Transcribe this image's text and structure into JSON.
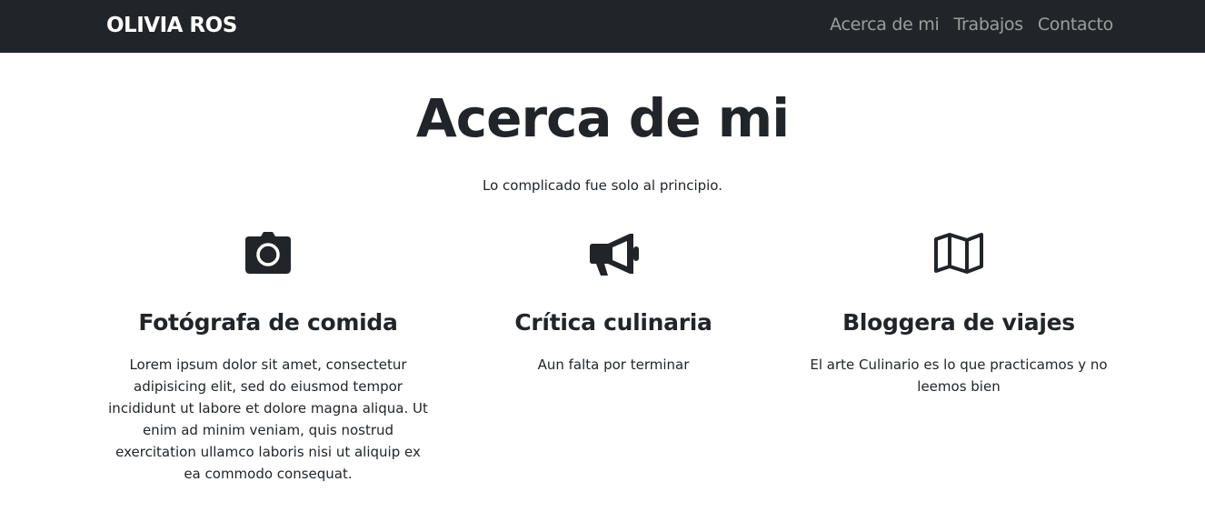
{
  "navbar": {
    "brand": "OLIVIA ROS",
    "links": [
      "Acerca de mi",
      "Trabajos",
      "Contacto"
    ]
  },
  "hero": {
    "title": "Acerca de mi",
    "subtitle": "Lo complicado fue solo al principio."
  },
  "features": [
    {
      "icon": "camera-icon",
      "title": "Fotógrafa de comida",
      "text": "Lorem ipsum dolor sit amet, consectetur adipisicing elit, sed do eiusmod tempor incididunt ut labore et dolore magna aliqua. Ut enim ad minim veniam, quis nostrud exercitation ullamco laboris nisi ut aliquip ex ea commodo consequat."
    },
    {
      "icon": "bullhorn-icon",
      "title": "Crítica culinaria",
      "text": "Aun falta por terminar"
    },
    {
      "icon": "map-icon",
      "title": "Bloggera de viajes",
      "text": "El arte Culinario es lo que practicamos y no leemos bien"
    }
  ],
  "colors": {
    "navbar_bg": "#212529",
    "text": "#212529",
    "nav_link": "rgba(255,255,255,0.55)"
  }
}
